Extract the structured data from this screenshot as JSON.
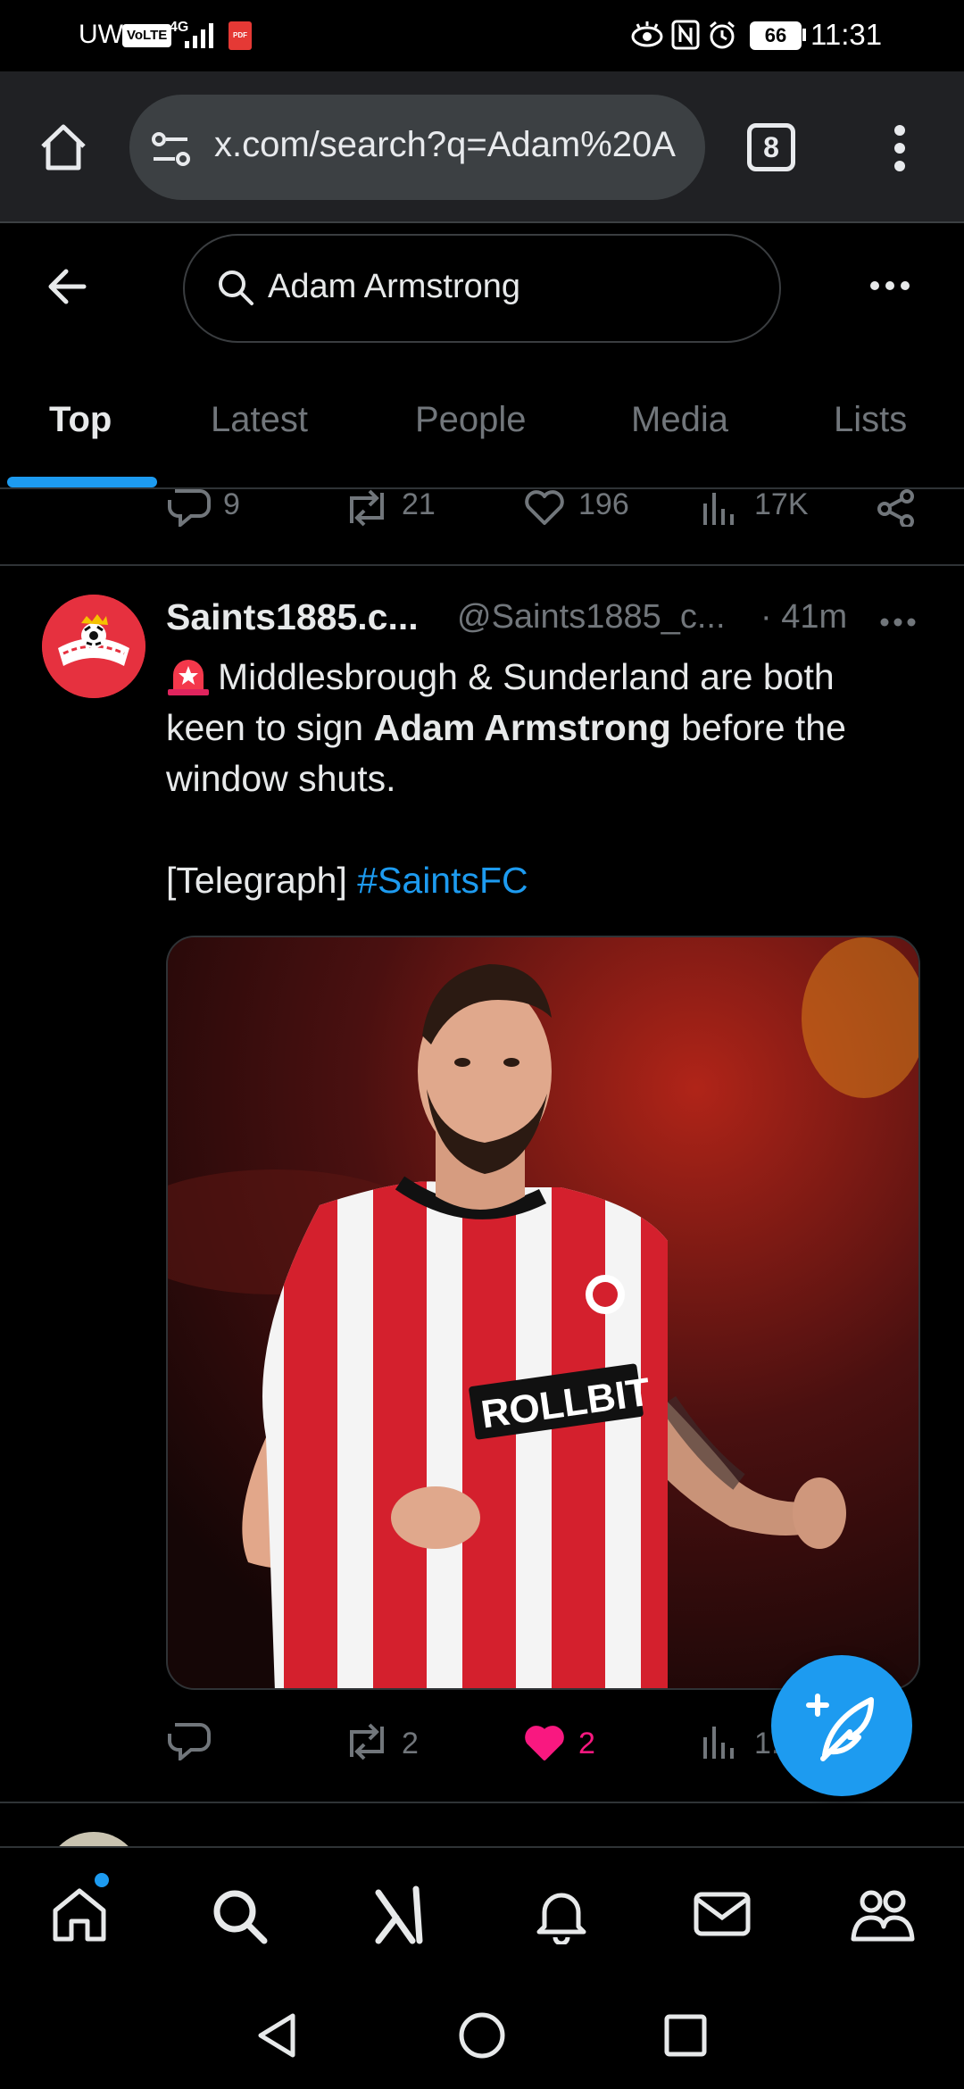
{
  "status_bar": {
    "carrier": "UW",
    "volte": "VoLTE",
    "network": "4G",
    "pdf_badge": "PDF",
    "battery": "66",
    "time": "11:31"
  },
  "browser": {
    "url": "x.com/search?q=Adam%20A",
    "tab_count": "8"
  },
  "search": {
    "query": "Adam Armstrong"
  },
  "tabs": [
    {
      "label": "Top",
      "active": true
    },
    {
      "label": "Latest",
      "active": false
    },
    {
      "label": "People",
      "active": false
    },
    {
      "label": "Media",
      "active": false
    },
    {
      "label": "Lists",
      "active": false
    }
  ],
  "prev_tweet_actions": {
    "replies": "9",
    "reposts": "21",
    "likes": "196",
    "views": "17K"
  },
  "tweet": {
    "display_name": "Saints1885.c...",
    "handle": "@Saints1885_c...",
    "time": "· 41m",
    "text_part1": "Middlesbrough & Sunderland are both keen to sign ",
    "text_bold": "Adam Armstrong",
    "text_part2": " before the window shuts.",
    "source": "[Telegraph] ",
    "hashtag": "#SaintsFC",
    "jersey_sponsor": "ROLLBIT",
    "actions": {
      "replies": "",
      "reposts": "2",
      "likes": "2",
      "views": "1."
    }
  },
  "colors": {
    "accent": "#1d9bf0",
    "like": "#f91880",
    "avatar_bg": "#e6313f"
  }
}
